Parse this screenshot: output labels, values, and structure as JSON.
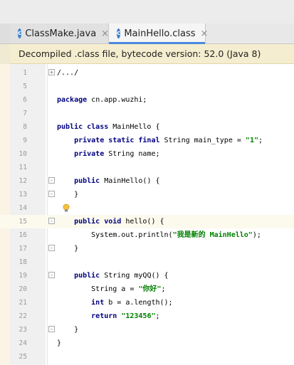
{
  "tabs": [
    {
      "label": "ClassMake.java",
      "icon": "class-c-icon",
      "active": false
    },
    {
      "label": "MainHello.class",
      "icon": "class-c-icon",
      "active": true
    }
  ],
  "tab_icon_letter": "c",
  "close_glyph": "×",
  "banner": {
    "text": "Decompiled .class file, bytecode version: 52.0 (Java 8)",
    "color": "#f5edcf"
  },
  "editor": {
    "current_line": 15,
    "lines": [
      {
        "n": "1",
        "tokens": [
          {
            "t": "/...",
            "c": "plain"
          },
          {
            "t": "/",
            "c": "plain"
          }
        ]
      },
      {
        "n": "5",
        "tokens": []
      },
      {
        "n": "6",
        "tokens": [
          {
            "t": "package",
            "c": "kw"
          },
          {
            "t": " cn.app.wuzhi;",
            "c": "plain"
          }
        ]
      },
      {
        "n": "7",
        "tokens": []
      },
      {
        "n": "8",
        "tokens": [
          {
            "t": "public class",
            "c": "kw"
          },
          {
            "t": " MainHello {",
            "c": "plain"
          }
        ]
      },
      {
        "n": "9",
        "tokens": [
          {
            "t": "    private static final",
            "c": "kw"
          },
          {
            "t": " String main_type = ",
            "c": "plain"
          },
          {
            "t": "\"1\"",
            "c": "str"
          },
          {
            "t": ";",
            "c": "plain"
          }
        ]
      },
      {
        "n": "10",
        "tokens": [
          {
            "t": "    private",
            "c": "kw"
          },
          {
            "t": " String name;",
            "c": "plain"
          }
        ]
      },
      {
        "n": "11",
        "tokens": []
      },
      {
        "n": "12",
        "tokens": [
          {
            "t": "    public",
            "c": "kw"
          },
          {
            "t": " MainHello() {",
            "c": "plain"
          }
        ]
      },
      {
        "n": "13",
        "tokens": [
          {
            "t": "    }",
            "c": "plain"
          }
        ]
      },
      {
        "n": "14",
        "tokens": []
      },
      {
        "n": "15",
        "tokens": [
          {
            "t": "    public void",
            "c": "kw"
          },
          {
            "t": " hello() {",
            "c": "plain"
          }
        ]
      },
      {
        "n": "16",
        "tokens": [
          {
            "t": "        System.out.println(",
            "c": "plain"
          },
          {
            "t": "\"我是新的 MainHello\"",
            "c": "str"
          },
          {
            "t": ");",
            "c": "plain"
          }
        ]
      },
      {
        "n": "17",
        "tokens": [
          {
            "t": "    }",
            "c": "plain"
          }
        ]
      },
      {
        "n": "18",
        "tokens": []
      },
      {
        "n": "19",
        "tokens": [
          {
            "t": "    public",
            "c": "kw"
          },
          {
            "t": " String myQQ() {",
            "c": "plain"
          }
        ]
      },
      {
        "n": "20",
        "tokens": [
          {
            "t": "        String a = ",
            "c": "plain"
          },
          {
            "t": "\"你好\"",
            "c": "str"
          },
          {
            "t": ";",
            "c": "plain"
          }
        ]
      },
      {
        "n": "21",
        "tokens": [
          {
            "t": "        int",
            "c": "kw"
          },
          {
            "t": " b = a.length();",
            "c": "plain"
          }
        ]
      },
      {
        "n": "22",
        "tokens": [
          {
            "t": "        return",
            "c": "kw"
          },
          {
            "t": " ",
            "c": "plain"
          },
          {
            "t": "\"123456\"",
            "c": "str"
          },
          {
            "t": ";",
            "c": "plain"
          }
        ]
      },
      {
        "n": "23",
        "tokens": [
          {
            "t": "    }",
            "c": "plain"
          }
        ]
      },
      {
        "n": "24",
        "tokens": [
          {
            "t": "}",
            "c": "plain"
          }
        ]
      },
      {
        "n": "25",
        "tokens": []
      }
    ],
    "fold_markers": [
      {
        "line": "1",
        "glyph": "+"
      },
      {
        "line": "12",
        "glyph": "-"
      },
      {
        "line": "13",
        "glyph": "-"
      },
      {
        "line": "15",
        "glyph": "-"
      },
      {
        "line": "17",
        "glyph": "-"
      },
      {
        "line": "19",
        "glyph": "-"
      },
      {
        "line": "23",
        "glyph": "-"
      }
    ],
    "intention_bulb_line": "14"
  }
}
